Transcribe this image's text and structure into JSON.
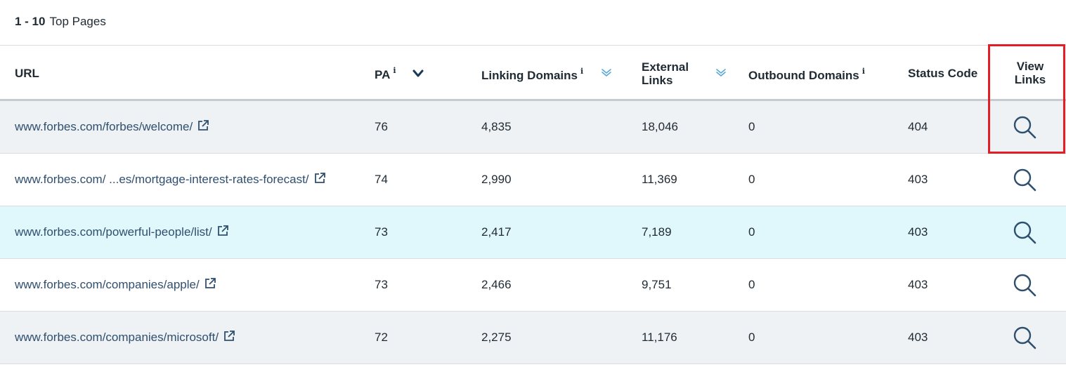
{
  "summary": {
    "range": "1 - 10",
    "label": "Top Pages"
  },
  "columns": {
    "url": "URL",
    "pa": "PA",
    "linking_domains": "Linking Domains",
    "external_links_line1": "External",
    "external_links_line2": "Links",
    "outbound_domains": "Outbound Domains",
    "status_code": "Status Code",
    "view_links_line1": "View",
    "view_links_line2": "Links",
    "info_mark": "i"
  },
  "colors": {
    "link_text": "#2f4f6f",
    "sort_active": "#1b3a57",
    "sort_inactive": "#5aa8d6",
    "row_alt": "#eff2f4",
    "row_highlight": "#e0f8fc",
    "annotation_box": "#e41c24"
  },
  "icons": {
    "external": "external-link-icon",
    "view": "search-icon",
    "sort_active": "chevron-down-icon",
    "sort_inactive": "double-chevron-down-icon"
  },
  "rows": [
    {
      "url": "www.forbes.com/forbes/welcome/",
      "pa": "76",
      "linking_domains": "4,835",
      "external_links": "18,046",
      "outbound_domains": "0",
      "status_code": "404"
    },
    {
      "url": "www.forbes.com/ ...es/mortgage-interest-rates-forecast/",
      "pa": "74",
      "linking_domains": "2,990",
      "external_links": "11,369",
      "outbound_domains": "0",
      "status_code": "403"
    },
    {
      "url": "www.forbes.com/powerful-people/list/",
      "pa": "73",
      "linking_domains": "2,417",
      "external_links": "7,189",
      "outbound_domains": "0",
      "status_code": "403"
    },
    {
      "url": "www.forbes.com/companies/apple/",
      "pa": "73",
      "linking_domains": "2,466",
      "external_links": "9,751",
      "outbound_domains": "0",
      "status_code": "403"
    },
    {
      "url": "www.forbes.com/companies/microsoft/",
      "pa": "72",
      "linking_domains": "2,275",
      "external_links": "11,176",
      "outbound_domains": "0",
      "status_code": "403"
    }
  ]
}
